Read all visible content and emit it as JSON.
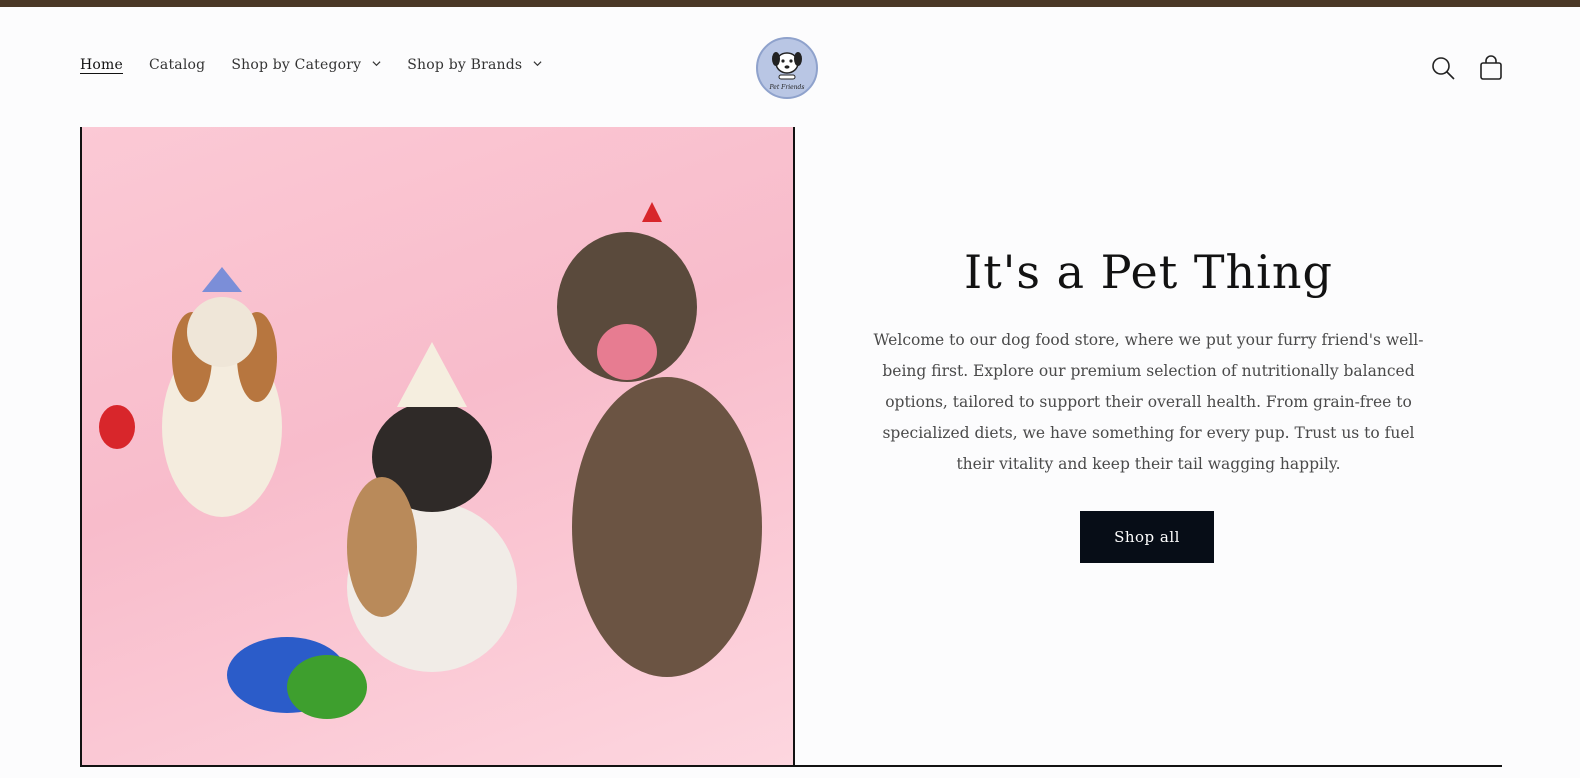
{
  "header": {
    "nav": [
      {
        "label": "Home",
        "active": true
      },
      {
        "label": "Catalog",
        "active": false
      },
      {
        "label": "Shop by Category",
        "active": false,
        "dropdown": true
      },
      {
        "label": "Shop by Brands",
        "active": false,
        "dropdown": true
      }
    ],
    "logo_text": "Pet Friends",
    "icons": [
      "search-icon",
      "cart-icon"
    ]
  },
  "hero": {
    "heading": "It's a Pet Thing",
    "text": "Welcome to our dog food store, where we put your furry friend's well-being first. Explore our premium selection of nutritionally balanced options, tailored to support their overall health. From grain-free to specialized diets, we have something for every pup. Trust us to fuel their vitality and keep their tail wagging happily.",
    "button_label": "Shop all"
  },
  "colors": {
    "topbar": "#4a3826",
    "button_bg": "#070d17",
    "image_bg": "#f8bccb"
  }
}
